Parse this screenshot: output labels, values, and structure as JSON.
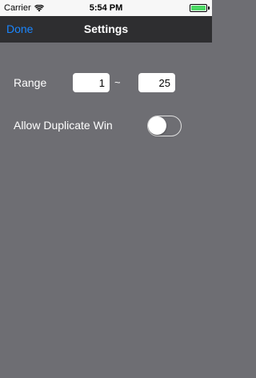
{
  "status_bar": {
    "carrier": "Carrier",
    "time": "5:54 PM",
    "battery_level": 1.0,
    "battery_color": "#4cd964"
  },
  "nav": {
    "done_label": "Done",
    "title": "Settings",
    "done_color": "#1a86ff"
  },
  "settings": {
    "range_label": "Range",
    "range_min": "1",
    "range_separator": "~",
    "range_max": "25",
    "allow_duplicate_label": "Allow Duplicate Win",
    "allow_duplicate_on": false
  },
  "icons": {
    "wifi": "wifi-icon",
    "battery": "battery-icon"
  }
}
